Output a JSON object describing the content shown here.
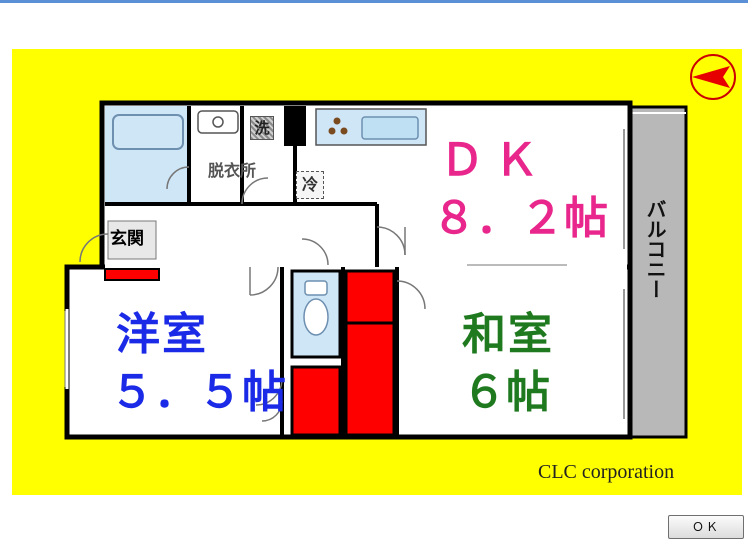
{
  "floorplan": {
    "rooms": {
      "dk_name": "ＤＫ",
      "dk_size": "８．２帖",
      "western_name": "洋室",
      "western_size": "５．５帖",
      "japanese_name": "和室",
      "japanese_size": "６帖",
      "dressing": "脱衣所",
      "entrance": "玄関",
      "balcony": "バルコニー"
    },
    "marks": {
      "washer": "洗",
      "fridge": "冷"
    },
    "company": "CLC corporation",
    "colors": {
      "background": "#ffff00",
      "wall": "#000000",
      "closet": "#ff0000",
      "wet_area": "#cfe6f7",
      "balcony": "#b8b8b8",
      "dk_text": "#e8268c",
      "western_text": "#1a2ae6",
      "japanese_text": "#1f7a1f"
    }
  },
  "dialog": {
    "ok_label": "ＯＫ"
  }
}
